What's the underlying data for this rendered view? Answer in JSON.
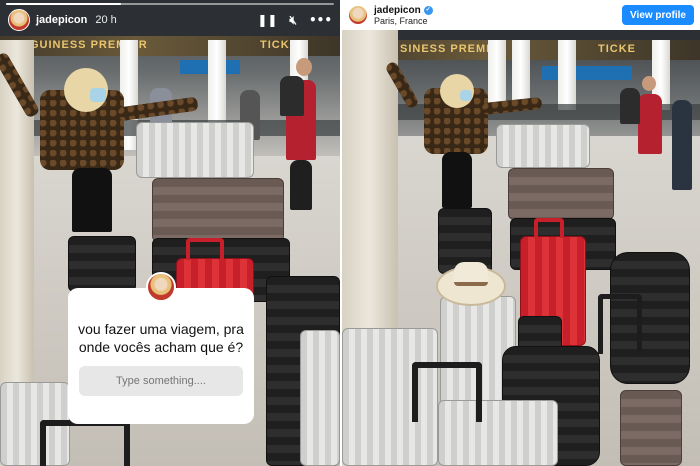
{
  "story": {
    "username": "jadepicon",
    "time": "20 h",
    "progress_fraction": 0.35,
    "controls": {
      "pause_icon": "pause-icon",
      "mute_icon": "mute-icon",
      "more_icon": "more-icon"
    },
    "question": {
      "text": "vou fazer uma viagem, pra onde vocês acham que é?",
      "placeholder": "Type something...."
    },
    "sign_text": "GUINESS PREMIER",
    "ticket_text": "TICKE"
  },
  "post": {
    "username": "jadepicon",
    "verified": true,
    "location": "Paris, France",
    "view_profile_label": "View profile",
    "sign_text": "SINESS PREMIER",
    "ticket_text": "TICKE"
  },
  "colors": {
    "accent": "#1a8cff",
    "verified": "#3897f0",
    "suitcase_red": "#de3239"
  }
}
